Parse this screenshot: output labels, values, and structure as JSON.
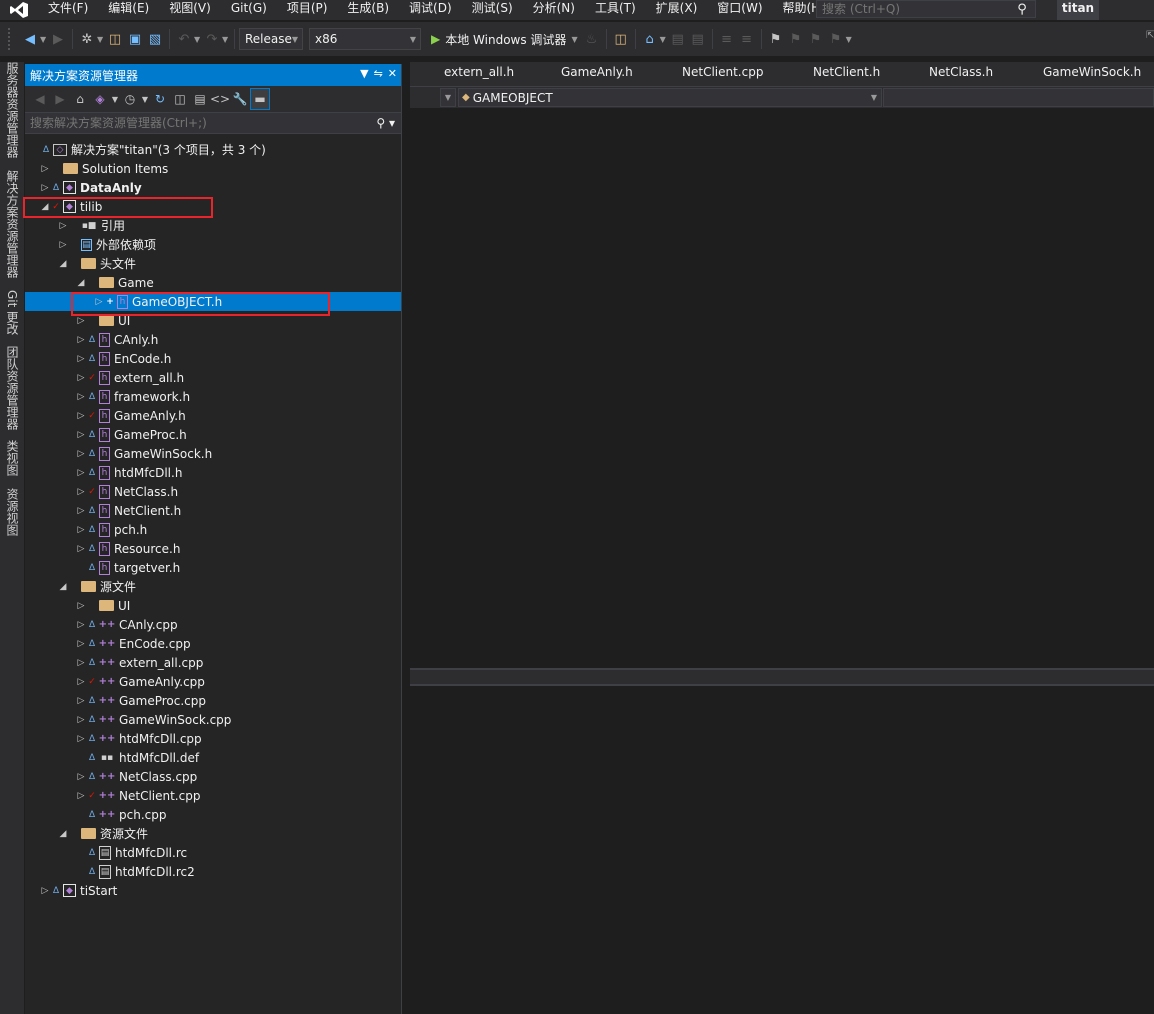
{
  "menubar": {
    "items": [
      "文件(F)",
      "编辑(E)",
      "视图(V)",
      "Git(G)",
      "项目(P)",
      "生成(B)",
      "调试(D)",
      "测试(S)",
      "分析(N)",
      "工具(T)",
      "扩展(X)",
      "窗口(W)",
      "帮助(H)"
    ],
    "search_placeholder": "搜索 (Ctrl+Q)",
    "solution_title": "titan"
  },
  "toolbar": {
    "configuration": "Release",
    "platform": "x86",
    "run_label": "本地 Windows 调试器"
  },
  "side_tabs": [
    "服务器资源管理器",
    "解决方案资源管理器",
    "Git 更改",
    "团队资源管理器",
    "类视图",
    "资源视图"
  ],
  "solution_explorer": {
    "title": "解决方案资源管理器",
    "search_placeholder": "搜索解决方案资源管理器(Ctrl+;)",
    "rows": [
      {
        "text": "解决方案\"titan\"(3 个项目，共 3 个)",
        "level": 0,
        "exp": "",
        "st": "lock",
        "icon": "sln"
      },
      {
        "text": "Solution Items",
        "level": 1,
        "exp": "closed",
        "st": "",
        "icon": "folder"
      },
      {
        "text": "DataAnly",
        "level": 1,
        "exp": "closed",
        "st": "lock",
        "icon": "proj",
        "bold": true
      },
      {
        "text": "tilib",
        "level": 1,
        "exp": "open",
        "st": "check",
        "icon": "proj"
      },
      {
        "text": "引用",
        "level": 2,
        "exp": "closed",
        "st": "",
        "icon": "ref"
      },
      {
        "text": "外部依赖项",
        "level": 2,
        "exp": "closed",
        "st": "",
        "icon": "ext"
      },
      {
        "text": "头文件",
        "level": 2,
        "exp": "open",
        "st": "",
        "icon": "filter"
      },
      {
        "text": "Game",
        "level": 3,
        "exp": "open",
        "st": "",
        "icon": "filter"
      },
      {
        "text": "GameOBJECT.h",
        "level": 4,
        "exp": "closed",
        "st": "plus",
        "icon": "h",
        "selected": true
      },
      {
        "text": "UI",
        "level": 3,
        "exp": "closed",
        "st": "",
        "icon": "filter"
      },
      {
        "text": "CAnly.h",
        "level": 3,
        "exp": "closed",
        "st": "lock",
        "icon": "h"
      },
      {
        "text": "EnCode.h",
        "level": 3,
        "exp": "closed",
        "st": "lock",
        "icon": "h"
      },
      {
        "text": "extern_all.h",
        "level": 3,
        "exp": "closed",
        "st": "check",
        "icon": "h"
      },
      {
        "text": "framework.h",
        "level": 3,
        "exp": "closed",
        "st": "lock",
        "icon": "h"
      },
      {
        "text": "GameAnly.h",
        "level": 3,
        "exp": "closed",
        "st": "check",
        "icon": "h"
      },
      {
        "text": "GameProc.h",
        "level": 3,
        "exp": "closed",
        "st": "lock",
        "icon": "h"
      },
      {
        "text": "GameWinSock.h",
        "level": 3,
        "exp": "closed",
        "st": "lock",
        "icon": "h"
      },
      {
        "text": "htdMfcDll.h",
        "level": 3,
        "exp": "closed",
        "st": "lock",
        "icon": "h"
      },
      {
        "text": "NetClass.h",
        "level": 3,
        "exp": "closed",
        "st": "check",
        "icon": "h"
      },
      {
        "text": "NetClient.h",
        "level": 3,
        "exp": "closed",
        "st": "lock",
        "icon": "h"
      },
      {
        "text": "pch.h",
        "level": 3,
        "exp": "closed",
        "st": "lock",
        "icon": "h"
      },
      {
        "text": "Resource.h",
        "level": 3,
        "exp": "closed",
        "st": "lock",
        "icon": "h"
      },
      {
        "text": "targetver.h",
        "level": 3,
        "exp": "",
        "st": "lock",
        "icon": "h"
      },
      {
        "text": "源文件",
        "level": 2,
        "exp": "open",
        "st": "",
        "icon": "filter"
      },
      {
        "text": "UI",
        "level": 3,
        "exp": "closed",
        "st": "",
        "icon": "filter"
      },
      {
        "text": "CAnly.cpp",
        "level": 3,
        "exp": "closed",
        "st": "lock",
        "icon": "cpp"
      },
      {
        "text": "EnCode.cpp",
        "level": 3,
        "exp": "closed",
        "st": "lock",
        "icon": "cpp"
      },
      {
        "text": "extern_all.cpp",
        "level": 3,
        "exp": "closed",
        "st": "lock",
        "icon": "cpp"
      },
      {
        "text": "GameAnly.cpp",
        "level": 3,
        "exp": "closed",
        "st": "check",
        "icon": "cpp"
      },
      {
        "text": "GameProc.cpp",
        "level": 3,
        "exp": "closed",
        "st": "lock",
        "icon": "cpp"
      },
      {
        "text": "GameWinSock.cpp",
        "level": 3,
        "exp": "closed",
        "st": "lock",
        "icon": "cpp"
      },
      {
        "text": "htdMfcDll.cpp",
        "level": 3,
        "exp": "closed",
        "st": "lock",
        "icon": "cpp"
      },
      {
        "text": "htdMfcDll.def",
        "level": 3,
        "exp": "",
        "st": "lock",
        "icon": "def"
      },
      {
        "text": "NetClass.cpp",
        "level": 3,
        "exp": "closed",
        "st": "lock",
        "icon": "cpp"
      },
      {
        "text": "NetClient.cpp",
        "level": 3,
        "exp": "closed",
        "st": "check",
        "icon": "cpp"
      },
      {
        "text": "pch.cpp",
        "level": 3,
        "exp": "",
        "st": "lock",
        "icon": "cpp"
      },
      {
        "text": "资源文件",
        "level": 2,
        "exp": "open",
        "st": "",
        "icon": "filter"
      },
      {
        "text": "htdMfcDll.rc",
        "level": 3,
        "exp": "",
        "st": "lock",
        "icon": "rc"
      },
      {
        "text": "htdMfcDll.rc2",
        "level": 3,
        "exp": "",
        "st": "lock",
        "icon": "rc"
      },
      {
        "text": "tiStart",
        "level": 1,
        "exp": "closed",
        "st": "lock",
        "icon": "proj"
      }
    ]
  },
  "editor": {
    "tabs": [
      "extern_all.h",
      "GameAnly.h",
      "NetClient.cpp",
      "NetClient.h",
      "NetClass.h",
      "GameWinSock.h"
    ],
    "nav_scope": "GAMEOBJECT"
  }
}
